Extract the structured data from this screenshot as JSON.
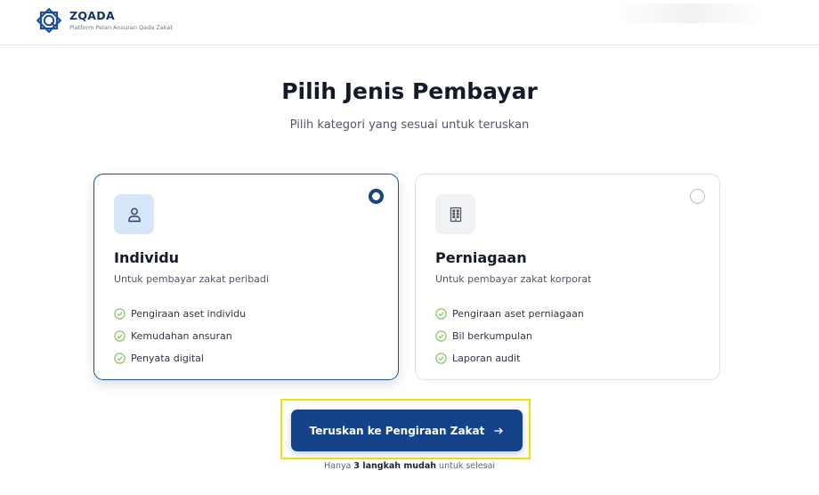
{
  "header": {
    "brand_name": "ZQADA",
    "tagline": "Platform Pelan Ansuran Qada Zakat"
  },
  "page": {
    "title": "Pilih Jenis Pembayar",
    "subtitle": "Pilih kategori yang sesuai untuk teruskan"
  },
  "options": [
    {
      "title": "Individu",
      "description": "Untuk pembayar zakat peribadi",
      "features": [
        "Pengiraan aset individu",
        "Kemudahan ansuran",
        "Penyata digital"
      ],
      "selected": true,
      "icon": "person-icon"
    },
    {
      "title": "Perniagaan",
      "description": "Untuk pembayar zakat korporat",
      "features": [
        "Pengiraan aset perniagaan",
        "Bil berkumpulan",
        "Laporan audit"
      ],
      "selected": false,
      "icon": "building-icon"
    }
  ],
  "cta": {
    "label": "Teruskan ke Pengiraan Zakat"
  },
  "footnote": {
    "prefix": "Hanya",
    "emphasis": "3 langkah mudah",
    "suffix": "untuk selesai"
  },
  "colors": {
    "primary": "#15438a",
    "selected_border": "#1c4d8d",
    "check": "#7ac14a",
    "highlight": "#f3e00a"
  }
}
